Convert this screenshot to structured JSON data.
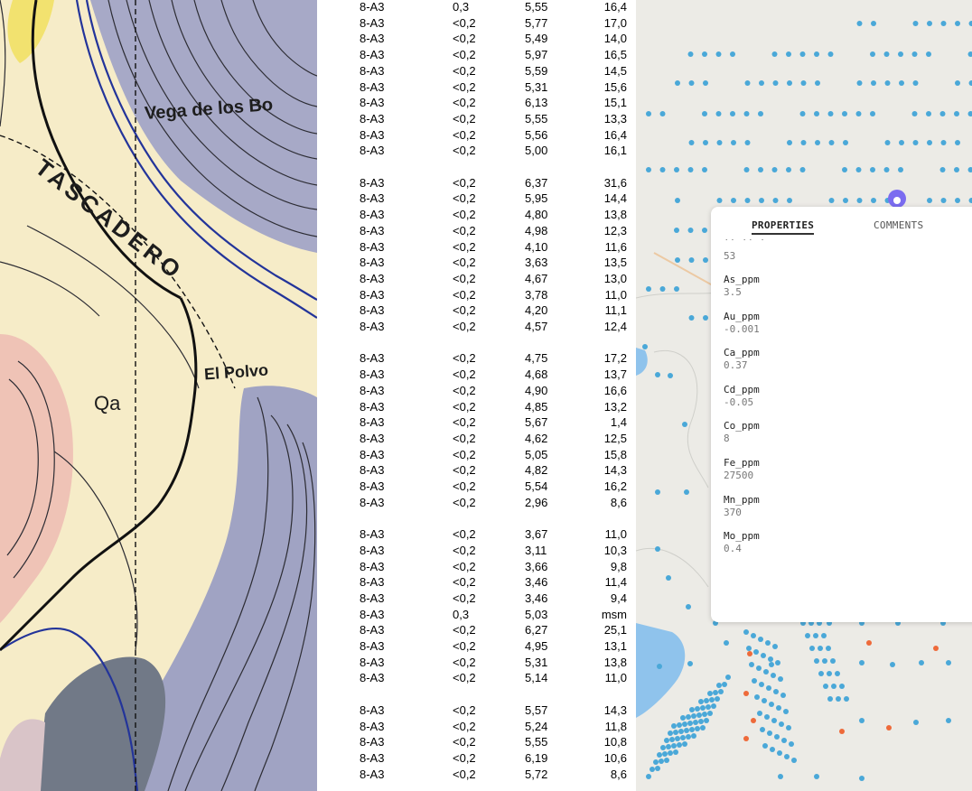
{
  "geo_map": {
    "labels": {
      "vega": "Vega de los Bo",
      "tascadero": "TASCADERO",
      "qa": "Qa",
      "polvo": "El Polvo"
    }
  },
  "data_table": {
    "rows": [
      [
        "8-A3",
        "0,3",
        "5,55",
        "16,4"
      ],
      [
        "8-A3",
        "<0,2",
        "5,77",
        "17,0"
      ],
      [
        "8-A3",
        "<0,2",
        "5,49",
        "14,0"
      ],
      [
        "8-A3",
        "<0,2",
        "5,97",
        "16,5"
      ],
      [
        "8-A3",
        "<0,2",
        "5,59",
        "14,5"
      ],
      [
        "8-A3",
        "<0,2",
        "5,31",
        "15,6"
      ],
      [
        "8-A3",
        "<0,2",
        "6,13",
        "15,1"
      ],
      [
        "8-A3",
        "<0,2",
        "5,55",
        "13,3"
      ],
      [
        "8-A3",
        "<0,2",
        "5,56",
        "16,4"
      ],
      [
        "8-A3",
        "<0,2",
        "5,00",
        "16,1"
      ],
      null,
      [
        "8-A3",
        "<0,2",
        "6,37",
        "31,6"
      ],
      [
        "8-A3",
        "<0,2",
        "5,95",
        "14,4"
      ],
      [
        "8-A3",
        "<0,2",
        "4,80",
        "13,8"
      ],
      [
        "8-A3",
        "<0,2",
        "4,98",
        "12,3"
      ],
      [
        "8-A3",
        "<0,2",
        "4,10",
        "11,6"
      ],
      [
        "8-A3",
        "<0,2",
        "3,63",
        "13,5"
      ],
      [
        "8-A3",
        "<0,2",
        "4,67",
        "13,0"
      ],
      [
        "8-A3",
        "<0,2",
        "3,78",
        "11,0"
      ],
      [
        "8-A3",
        "<0,2",
        "4,20",
        "11,1"
      ],
      [
        "8-A3",
        "<0,2",
        "4,57",
        "12,4"
      ],
      null,
      [
        "8-A3",
        "<0,2",
        "4,75",
        "17,2"
      ],
      [
        "8-A3",
        "<0,2",
        "4,68",
        "13,7"
      ],
      [
        "8-A3",
        "<0,2",
        "4,90",
        "16,6"
      ],
      [
        "8-A3",
        "<0,2",
        "4,85",
        "13,2"
      ],
      [
        "8-A3",
        "<0,2",
        "5,67",
        "1,4"
      ],
      [
        "8-A3",
        "<0,2",
        "4,62",
        "12,5"
      ],
      [
        "8-A3",
        "<0,2",
        "5,05",
        "15,8"
      ],
      [
        "8-A3",
        "<0,2",
        "4,82",
        "14,3"
      ],
      [
        "8-A3",
        "<0,2",
        "5,54",
        "16,2"
      ],
      [
        "8-A3",
        "<0,2",
        "2,96",
        "8,6"
      ],
      null,
      [
        "8-A3",
        "<0,2",
        "3,67",
        "11,0"
      ],
      [
        "8-A3",
        "<0,2",
        "3,11",
        "10,3"
      ],
      [
        "8-A3",
        "<0,2",
        "3,66",
        "9,8"
      ],
      [
        "8-A3",
        "<0,2",
        "3,46",
        "11,4"
      ],
      [
        "8-A3",
        "<0,2",
        "3,46",
        "9,4"
      ],
      [
        "8-A3",
        "0,3",
        "5,03",
        "msm"
      ],
      [
        "8-A3",
        "<0,2",
        "6,27",
        "25,1"
      ],
      [
        "8-A3",
        "<0,2",
        "4,95",
        "13,1"
      ],
      [
        "8-A3",
        "<0,2",
        "5,31",
        "13,8"
      ],
      [
        "8-A3",
        "<0,2",
        "5,14",
        "11,0"
      ],
      null,
      [
        "8-A3",
        "<0,2",
        "5,57",
        "14,3"
      ],
      [
        "8-A3",
        "<0,2",
        "5,24",
        "11,8"
      ],
      [
        "8-A3",
        "<0,2",
        "5,55",
        "10,8"
      ],
      [
        "8-A3",
        "<0,2",
        "6,19",
        "10,6"
      ],
      [
        "8-A3",
        "<0,2",
        "5,72",
        "8,6"
      ]
    ]
  },
  "web_map": {
    "colors": {
      "sample_dot": "#4aa8d8",
      "highlight_dot": "#ee6a3a",
      "selected_marker": "#7b6cf0",
      "water": "#8fc3ec"
    },
    "properties_panel": {
      "tabs": {
        "properties": "PROPERTIES",
        "comments": "COMMENTS"
      },
      "active_tab": "PROPERTIES",
      "partial_value": "53",
      "items": [
        {
          "key": "As_ppm",
          "value": "3.5"
        },
        {
          "key": "Au_ppm",
          "value": "-0.001"
        },
        {
          "key": "Ca_ppm",
          "value": "0.37"
        },
        {
          "key": "Cd_ppm",
          "value": "-0.05"
        },
        {
          "key": "Co_ppm",
          "value": "8"
        },
        {
          "key": "Fe_ppm",
          "value": "27500"
        },
        {
          "key": "Mn_ppm",
          "value": "370"
        },
        {
          "key": "Mo_ppm",
          "value": "0.4"
        }
      ]
    }
  }
}
